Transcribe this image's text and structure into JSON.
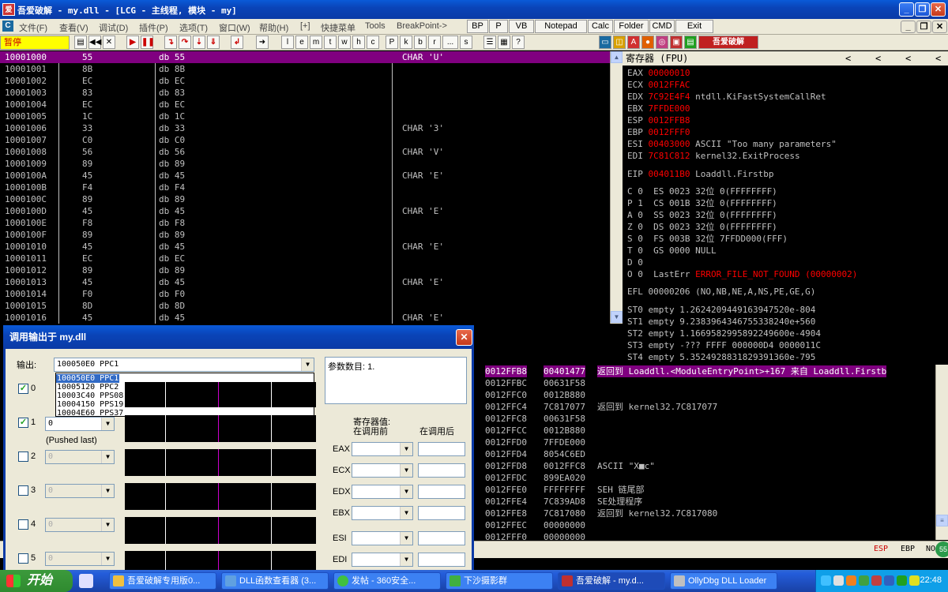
{
  "title": "吾爱破解 - my.dll - [LCG -  主线程, 模块 - my]",
  "menu": {
    "items": [
      "文件(F)",
      "查看(V)",
      "调试(D)",
      "插件(P)",
      "选项(T)",
      "窗口(W)",
      "帮助(H)",
      "[+]",
      "快捷菜单",
      "Tools",
      "BreakPoint->"
    ],
    "quick_buttons": [
      "BP",
      "P",
      "VB",
      "Notepad",
      "Calc",
      "Folder",
      "CMD",
      "Exit"
    ]
  },
  "toolbar": {
    "status": "暂停",
    "letters": [
      "l",
      "e",
      "m",
      "t",
      "w",
      "h",
      "c",
      "P",
      "k",
      "b",
      "r",
      "...",
      "s"
    ],
    "plugin_text": "吾爱破解"
  },
  "disasm": {
    "rows": [
      {
        "addr": "10001000",
        "hex": "55",
        "cmd": "db 55",
        "comment": "CHAR 'U'"
      },
      {
        "addr": "10001001",
        "hex": "8B",
        "cmd": "db 8B",
        "comment": ""
      },
      {
        "addr": "10001002",
        "hex": "EC",
        "cmd": "db EC",
        "comment": ""
      },
      {
        "addr": "10001003",
        "hex": "83",
        "cmd": "db 83",
        "comment": ""
      },
      {
        "addr": "10001004",
        "hex": "EC",
        "cmd": "db EC",
        "comment": ""
      },
      {
        "addr": "10001005",
        "hex": "1C",
        "cmd": "db 1C",
        "comment": ""
      },
      {
        "addr": "10001006",
        "hex": "33",
        "cmd": "db 33",
        "comment": "CHAR '3'"
      },
      {
        "addr": "10001007",
        "hex": "C0",
        "cmd": "db C0",
        "comment": ""
      },
      {
        "addr": "10001008",
        "hex": "56",
        "cmd": "db 56",
        "comment": "CHAR 'V'"
      },
      {
        "addr": "10001009",
        "hex": "89",
        "cmd": "db 89",
        "comment": ""
      },
      {
        "addr": "1000100A",
        "hex": "45",
        "cmd": "db 45",
        "comment": "CHAR 'E'"
      },
      {
        "addr": "1000100B",
        "hex": "F4",
        "cmd": "db F4",
        "comment": ""
      },
      {
        "addr": "1000100C",
        "hex": "89",
        "cmd": "db 89",
        "comment": ""
      },
      {
        "addr": "1000100D",
        "hex": "45",
        "cmd": "db 45",
        "comment": "CHAR 'E'"
      },
      {
        "addr": "1000100E",
        "hex": "F8",
        "cmd": "db F8",
        "comment": ""
      },
      {
        "addr": "1000100F",
        "hex": "89",
        "cmd": "db 89",
        "comment": ""
      },
      {
        "addr": "10001010",
        "hex": "45",
        "cmd": "db 45",
        "comment": "CHAR 'E'"
      },
      {
        "addr": "10001011",
        "hex": "EC",
        "cmd": "db EC",
        "comment": ""
      },
      {
        "addr": "10001012",
        "hex": "89",
        "cmd": "db 89",
        "comment": ""
      },
      {
        "addr": "10001013",
        "hex": "45",
        "cmd": "db 45",
        "comment": "CHAR 'E'"
      },
      {
        "addr": "10001014",
        "hex": "F0",
        "cmd": "db F0",
        "comment": ""
      },
      {
        "addr": "10001015",
        "hex": "8D",
        "cmd": "db 8D",
        "comment": ""
      },
      {
        "addr": "10001016",
        "hex": "45",
        "cmd": "db 45",
        "comment": "CHAR 'E'"
      }
    ]
  },
  "registers": {
    "header": "寄存器 (FPU)",
    "nav": [
      "<",
      "<",
      "<",
      "<"
    ],
    "lines": [
      {
        "name": "EAX",
        "value": "00000010",
        "extra": ""
      },
      {
        "name": "ECX",
        "value": "0012FFAC",
        "extra": ""
      },
      {
        "name": "EDX",
        "value": "7C92E4F4",
        "extra": "ntdll.KiFastSystemCallRet"
      },
      {
        "name": "EBX",
        "value": "7FFDE000",
        "extra": ""
      },
      {
        "name": "ESP",
        "value": "0012FFB8",
        "extra": ""
      },
      {
        "name": "EBP",
        "value": "0012FFF0",
        "extra": ""
      },
      {
        "name": "ESI",
        "value": "00403000",
        "extra": "ASCII \"Too many parameters\""
      },
      {
        "name": "EDI",
        "value": "7C81C812",
        "extra": "kernel32.ExitProcess"
      }
    ],
    "eip": {
      "name": "EIP",
      "value": "004011B0",
      "extra": "Loaddll.Firstbp"
    },
    "flags": [
      "C 0  ES 0023 32位 0(FFFFFFFF)",
      "P 1  CS 001B 32位 0(FFFFFFFF)",
      "A 0  SS 0023 32位 0(FFFFFFFF)",
      "Z 0  DS 0023 32位 0(FFFFFFFF)",
      "S 0  FS 003B 32位 7FFDD000(FFF)",
      "T 0  GS 0000 NULL",
      "D 0"
    ],
    "lasterr": {
      "prefix": "O 0  LastErr ",
      "value": "ERROR_FILE_NOT_FOUND (00000002)"
    },
    "efl": "EFL 00000206 (NO,NB,NE,A,NS,PE,GE,G)",
    "fpu": [
      "ST0 empty 1.2624209449163947520e-804",
      "ST1 empty 9.2383964346755338240e+560",
      "ST2 empty 1.1669582995892249600e-4904",
      "ST3 empty -??? FFFF 000000D4 0000011C",
      "ST4 empty 5.3524928831829391360e-795"
    ]
  },
  "stack": {
    "rows": [
      {
        "addr": "0012FFB8",
        "val": "00401477",
        "comment": "返回到 Loaddll.<ModuleEntryPoint>+167 来自 Loaddll.Firstb"
      },
      {
        "addr": "0012FFBC",
        "val": "00631F58",
        "comment": ""
      },
      {
        "addr": "0012FFC0",
        "val": "0012B880",
        "comment": ""
      },
      {
        "addr": "0012FFC4",
        "val": "7C817077",
        "comment": "返回到 kernel32.7C817077"
      },
      {
        "addr": "0012FFC8",
        "val": "00631F58",
        "comment": ""
      },
      {
        "addr": "0012FFCC",
        "val": "0012B880",
        "comment": ""
      },
      {
        "addr": "0012FFD0",
        "val": "7FFDE000",
        "comment": ""
      },
      {
        "addr": "0012FFD4",
        "val": "8054C6ED",
        "comment": ""
      },
      {
        "addr": "0012FFD8",
        "val": "0012FFC8",
        "comment": "ASCII \"X■c\""
      },
      {
        "addr": "0012FFDC",
        "val": "899EA020",
        "comment": ""
      },
      {
        "addr": "0012FFE0",
        "val": "FFFFFFFF",
        "comment": "SEH 链尾部"
      },
      {
        "addr": "0012FFE4",
        "val": "7C839AD8",
        "comment": "SE处理程序"
      },
      {
        "addr": "0012FFE8",
        "val": "7C817080",
        "comment": "返回到 kernel32.7C817080"
      },
      {
        "addr": "0012FFEC",
        "val": "00000000",
        "comment": ""
      },
      {
        "addr": "0012FFF0",
        "val": "00000000",
        "comment": ""
      }
    ]
  },
  "statusbar": {
    "items": [
      "ESP",
      "EBP",
      "NO"
    ],
    "badge": "55"
  },
  "dialog": {
    "title": "调用输出于 my.dll",
    "output_label": "输出:",
    "selected_export": "100050E0  PPC1",
    "export_options": [
      "100050E0  PPC1",
      "10005120  PPC2",
      "10003C40  PPS08",
      "10004150  PPS19",
      "10004E60  PPS37"
    ],
    "param_count_label": "参数数目: 1.",
    "pushed_last": "(Pushed last)",
    "arg0_label": "0",
    "args": [
      {
        "label": "1",
        "value": "0"
      },
      {
        "label": "2",
        "value": "0"
      },
      {
        "label": "3",
        "value": "0"
      },
      {
        "label": "4",
        "value": "0"
      },
      {
        "label": "5",
        "value": "0"
      }
    ],
    "reg_header_1": "寄存器值:",
    "reg_header_2": "在调用前",
    "reg_header_3": "在调用后",
    "reg_labels": [
      "EAX",
      "ECX",
      "EDX",
      "EBX",
      "ESI",
      "EDI"
    ]
  },
  "taskbar": {
    "start": "开始",
    "tasks": [
      "吾爱破解专用版0...",
      "DLL函数查看器 (3...",
      "发帖 - 360安全...",
      "下沙摄影群",
      "吾爱破解 - my.d...",
      "OllyDbg DLL Loader"
    ],
    "time": "22:48"
  }
}
